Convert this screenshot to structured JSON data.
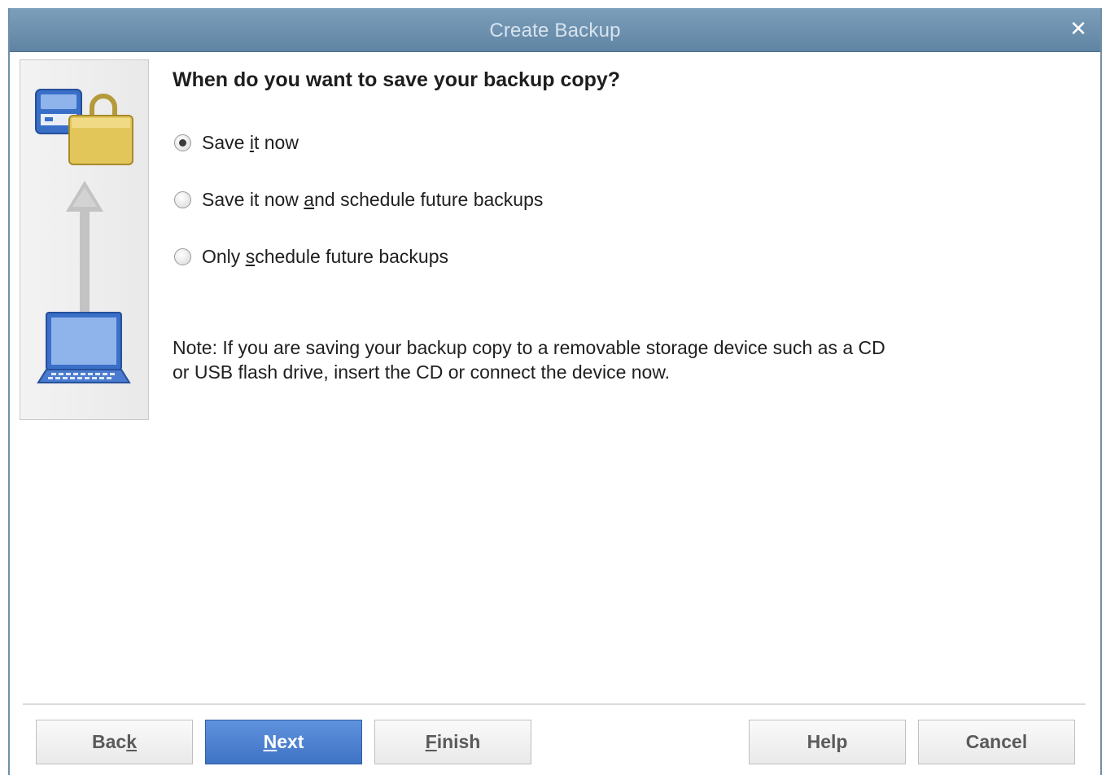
{
  "window": {
    "title": "Create Backup",
    "close_glyph": "✕"
  },
  "main": {
    "heading": "When do you want to save your backup copy?",
    "options": [
      {
        "label_pre": "Save ",
        "label_key": "i",
        "label_post": "t now",
        "selected": true
      },
      {
        "label_pre": "Save it now ",
        "label_key": "a",
        "label_post": "nd schedule future backups",
        "selected": false
      },
      {
        "label_pre": "Only ",
        "label_key": "s",
        "label_post": "chedule future backups",
        "selected": false
      }
    ],
    "note_line1": "Note: If you are saving your backup copy to a removable storage device such as a CD",
    "note_line2": "or USB flash drive, insert the CD or connect the device now."
  },
  "buttons": {
    "back": {
      "pre": "Bac",
      "key": "k",
      "post": ""
    },
    "next": {
      "pre": "",
      "key": "N",
      "post": "ext"
    },
    "finish": {
      "pre": "",
      "key": "F",
      "post": "inish"
    },
    "help": {
      "label": "Help"
    },
    "cancel": {
      "label": "Cancel"
    }
  },
  "icons": {
    "backup_graphic": "backup-drive-lock-laptop-icon"
  },
  "colors": {
    "titlebar": "#6f93b0",
    "primary_button": "#4a7fd0"
  }
}
